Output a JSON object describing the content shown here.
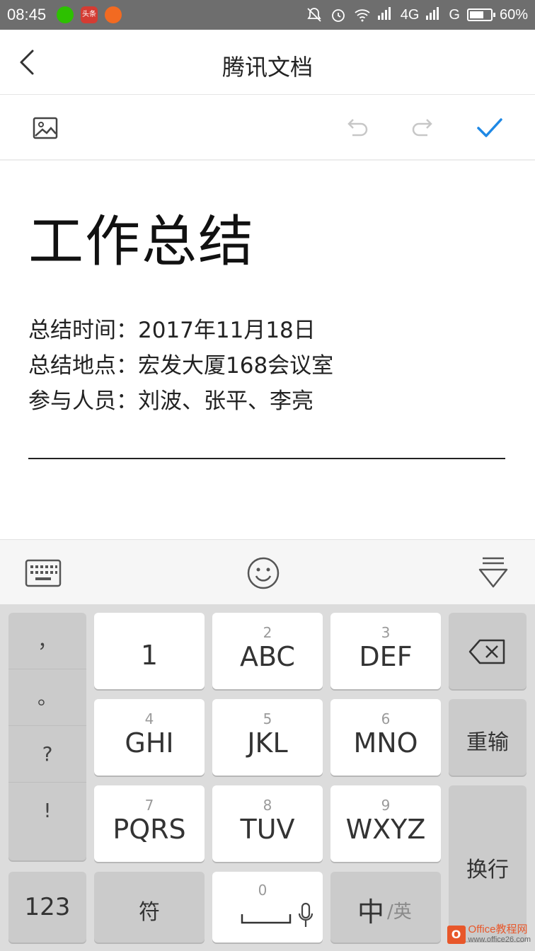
{
  "status_bar": {
    "time": "08:45",
    "toutiao_label": "头条",
    "network": "4G",
    "network2": "G",
    "battery": "60%",
    "colors": {
      "bar": "#6e6e6e"
    }
  },
  "header": {
    "title": "腾讯文档",
    "back_icon": "chevron-left-icon"
  },
  "toolbar": {
    "image_icon": "image-icon",
    "undo_icon": "undo-icon",
    "redo_icon": "redo-icon",
    "done_icon": "check-icon",
    "accent": "#1e88e5"
  },
  "document": {
    "title": "工作总结",
    "lines": [
      "总结时间：2017年11月18日",
      "总结地点：宏发大厦168会议室",
      "参与人员：刘波、张平、李亮"
    ]
  },
  "keyboard": {
    "top_bar": {
      "keyboard_icon": "keyboard-icon",
      "emoji_icon": "emoji-icon",
      "collapse_icon": "collapse-keyboard-icon"
    },
    "punctuation": [
      "，",
      "。",
      "?",
      "!"
    ],
    "keys": {
      "k1": {
        "num": "",
        "label": "1"
      },
      "k2": {
        "num": "2",
        "label": "ABC"
      },
      "k3": {
        "num": "3",
        "label": "DEF"
      },
      "k4": {
        "num": "4",
        "label": "GHI"
      },
      "k5": {
        "num": "5",
        "label": "JKL"
      },
      "k6": {
        "num": "6",
        "label": "MNO"
      },
      "k7": {
        "num": "7",
        "label": "PQRS"
      },
      "k8": {
        "num": "8",
        "label": "TUV"
      },
      "k9": {
        "num": "9",
        "label": "WXYZ"
      },
      "k0": {
        "num": "0"
      }
    },
    "reset": "重输",
    "enter": "换行",
    "numbers": "123",
    "symbols": "符",
    "lang_cn": "中",
    "lang_en": "/英"
  },
  "watermark": {
    "brand": "Office教程网",
    "url": "www.office26.com"
  }
}
